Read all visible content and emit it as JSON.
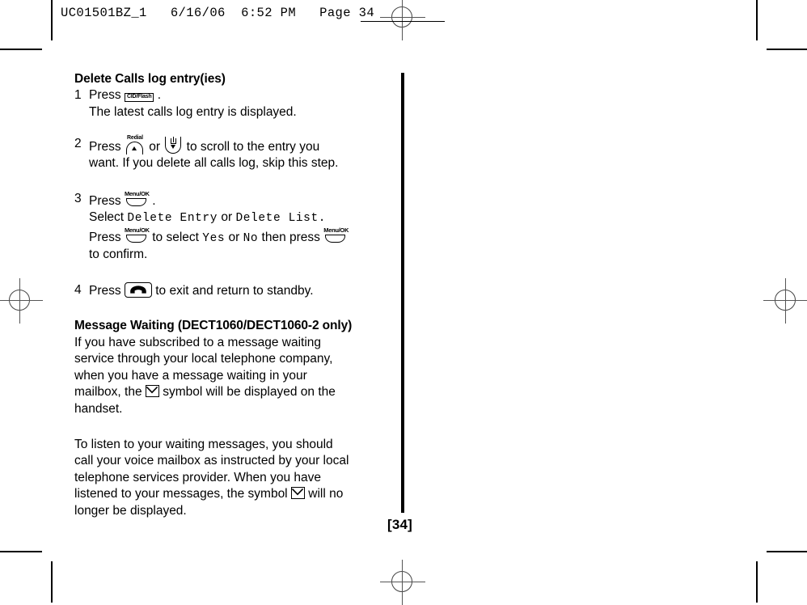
{
  "print_header": {
    "text": "UC01501BZ_1   6/16/06  6:52 PM   Page 34"
  },
  "page": {
    "number_label": "[34]"
  },
  "section1": {
    "title": "Delete Calls log entry(ies)",
    "steps": [
      {
        "num": "1",
        "press_label": "Press",
        "key": "CID/Flash",
        "period": ".",
        "detail": "The latest calls log entry is displayed."
      },
      {
        "num": "2",
        "press_label": "Press",
        "key_a": "Redial",
        "or_label": "or",
        "tail": "to scroll to the entry you",
        "detail": "want. If you delete all calls log, skip this step."
      },
      {
        "num": "3",
        "press_label": "Press",
        "key": "Menu/OK",
        "period": ".",
        "select_label": "Select",
        "option_1": "Delete Entry",
        "option_or": "or",
        "option_2": "Delete List.",
        "press2_label": "Press",
        "to_select_label": "to select",
        "yes_label": "Yes",
        "yesno_or": "or",
        "no_label": "No",
        "then_press_label": "then press",
        "confirm_label": "to confirm."
      },
      {
        "num": "4",
        "press_label": "Press",
        "key": "end-call-key",
        "tail": "to exit and return to standby."
      }
    ]
  },
  "section2": {
    "title": "Message Waiting (DECT1060/DECT1060-2 only)",
    "para1_a": "If you have subscribed to a message waiting",
    "para1_b": "service through your local telephone company,",
    "para1_c": "when you have a message waiting in your",
    "para1_d_pre": "mailbox, the",
    "para1_d_post": "symbol will be displayed on the",
    "para1_e": "handset.",
    "para2_a": "To listen to your waiting messages, you should",
    "para2_b": "call your voice mailbox as instructed by your local",
    "para2_c": "telephone services provider. When you have",
    "para2_d_pre": "listened to your messages, the symbol",
    "para2_d_post": "will no",
    "para2_e": "longer be displayed."
  }
}
